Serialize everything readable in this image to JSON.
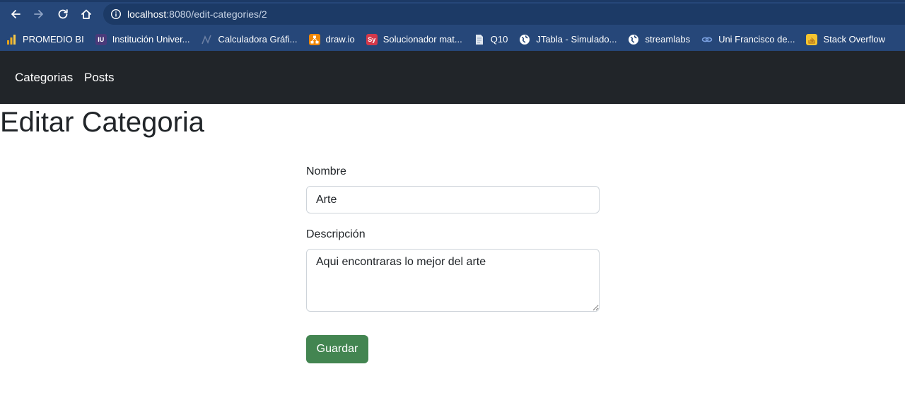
{
  "browser": {
    "url_host": "localhost",
    "url_path": ":8080/edit-categories/2",
    "icons": {
      "back": "arrow-left-icon",
      "forward": "arrow-right-icon",
      "reload": "reload-icon",
      "home": "home-icon",
      "site_info": "info-icon"
    }
  },
  "bookmarks": [
    {
      "label": "PROMEDIO BI",
      "icon": "bar-chart-icon",
      "color": "#f2b01e"
    },
    {
      "label": "Institución Univer...",
      "icon": "institution-icon",
      "color": "#4a3a7a"
    },
    {
      "label": "Calculadora Gráfi...",
      "icon": "graph-icon",
      "color": "#3a4a6a"
    },
    {
      "label": "draw.io",
      "icon": "drawio-icon",
      "color": "#f08705"
    },
    {
      "label": "Solucionador mat...",
      "icon": "symbolab-icon",
      "color": "#d4384a"
    },
    {
      "label": "Q10",
      "icon": "document-icon",
      "color": "#dfe6ef"
    },
    {
      "label": "JTabla - Simulado...",
      "icon": "globe-icon",
      "color": "#ffffff"
    },
    {
      "label": "streamlabs",
      "icon": "globe-icon",
      "color": "#ffffff"
    },
    {
      "label": "Uni Francisco de...",
      "icon": "link-icon",
      "color": "#7aa0e0"
    },
    {
      "label": "Stack Overflow",
      "icon": "stack-overflow-icon",
      "color": "#f4c430"
    }
  ],
  "navbar": {
    "links": [
      "Categorias",
      "Posts"
    ]
  },
  "page": {
    "title": "Editar Categoria",
    "form": {
      "name_label": "Nombre",
      "name_value": "Arte",
      "description_label": "Descripción",
      "description_value": "Aqui encontraras lo mejor del arte",
      "submit_label": "Guardar"
    }
  },
  "colors": {
    "browser_chrome": "#264779",
    "navbar": "#212529",
    "submit_button": "#438551"
  }
}
